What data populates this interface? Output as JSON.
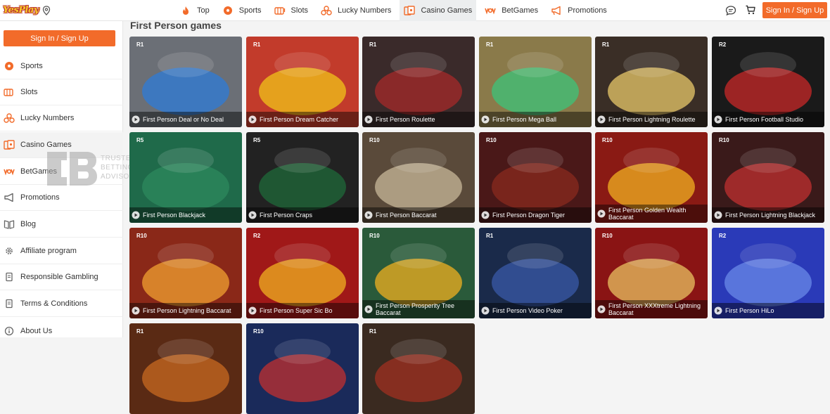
{
  "brand": {
    "logo_text": "YesPlay",
    "accent": "#f26b2a"
  },
  "nav": [
    {
      "label": "Top",
      "icon": "fire-icon"
    },
    {
      "label": "Sports",
      "icon": "soccer-ball-icon"
    },
    {
      "label": "Slots",
      "icon": "slots-icon"
    },
    {
      "label": "Lucky Numbers",
      "icon": "lottery-balls-icon"
    },
    {
      "label": "Casino Games",
      "icon": "casino-icon"
    },
    {
      "label": "BetGames",
      "icon": "betgames-icon"
    },
    {
      "label": "Promotions",
      "icon": "megaphone-icon"
    }
  ],
  "header": {
    "signin_label": "Sign In / Sign Up"
  },
  "sidebar": {
    "signin_label": "Sign In / Sign Up",
    "items": [
      {
        "label": "Sports",
        "icon": "soccer-ball-icon"
      },
      {
        "label": "Slots",
        "icon": "slots-icon"
      },
      {
        "label": "Lucky Numbers",
        "icon": "lottery-balls-icon"
      },
      {
        "label": "Casino Games",
        "icon": "casino-icon"
      },
      {
        "label": "BetGames",
        "icon": "betgames-icon"
      },
      {
        "label": "Promotions",
        "icon": "megaphone-icon"
      },
      {
        "label": "Blog",
        "icon": "book-icon"
      },
      {
        "label": "Affiliate program",
        "icon": "gear-icon"
      },
      {
        "label": "Responsible Gambling",
        "icon": "document-icon"
      },
      {
        "label": "Terms & Conditions",
        "icon": "document-icon"
      },
      {
        "label": "About Us",
        "icon": "info-icon"
      }
    ]
  },
  "watermark": {
    "line1": "TRUSTED",
    "line2": "BETTING",
    "line3": "ADVISOR"
  },
  "section": {
    "title": "First Person games"
  },
  "games": [
    {
      "name": "First Person Deal or No Deal",
      "badge": "R1",
      "bg": "#6b6f76",
      "accent": "#2d7bd8"
    },
    {
      "name": "First Person Dream Catcher",
      "badge": "R1",
      "bg": "#c23b2b",
      "accent": "#f0c419"
    },
    {
      "name": "First Person Roulette",
      "badge": "R1",
      "bg": "#3a2a2a",
      "accent": "#a52a2a"
    },
    {
      "name": "First Person Mega Ball",
      "badge": "R1",
      "bg": "#8a7a4a",
      "accent": "#3cc47a"
    },
    {
      "name": "First Person Lightning Roulette",
      "badge": "R1",
      "bg": "#3a2e26",
      "accent": "#e8c86a"
    },
    {
      "name": "First Person Football Studio",
      "badge": "R2",
      "bg": "#1a1a1a",
      "accent": "#c82828"
    },
    {
      "name": "First Person Blackjack",
      "badge": "R5",
      "bg": "#1f6a4a",
      "accent": "#2d8a5e"
    },
    {
      "name": "First Person Craps",
      "badge": "R5",
      "bg": "#222",
      "accent": "#1f6a3a"
    },
    {
      "name": "First Person Baccarat",
      "badge": "R10",
      "bg": "#5a4a3a",
      "accent": "#c8b89a"
    },
    {
      "name": "First Person Dragon Tiger",
      "badge": "R10",
      "bg": "#4a1818",
      "accent": "#8a2a1e"
    },
    {
      "name": "First Person Golden Wealth Baccarat",
      "badge": "R10",
      "bg": "#8a1a14",
      "accent": "#f0b020"
    },
    {
      "name": "First Person Lightning Blackjack",
      "badge": "R10",
      "bg": "#3a1a1a",
      "accent": "#c03030"
    },
    {
      "name": "First Person Lightning Baccarat",
      "badge": "R10",
      "bg": "#8a2818",
      "accent": "#f0a030"
    },
    {
      "name": "First Person Super Sic Bo",
      "badge": "R2",
      "bg": "#a01818",
      "accent": "#f0b020"
    },
    {
      "name": "First Person Prosperity Tree Baccarat",
      "badge": "R10",
      "bg": "#2a5a3a",
      "accent": "#f0b020"
    },
    {
      "name": "First Person Video Poker",
      "badge": "R1",
      "bg": "#1a2a4a",
      "accent": "#3a5aa8"
    },
    {
      "name": "First Person XXXtreme Lightning Baccarat",
      "badge": "R10",
      "bg": "#8a1414",
      "accent": "#e8c060"
    },
    {
      "name": "First Person HiLo",
      "badge": "R2",
      "bg": "#2a3ab8",
      "accent": "#6a8ae8"
    },
    {
      "name": "",
      "badge": "R1",
      "bg": "#5a2a14",
      "accent": "#c86a20"
    },
    {
      "name": "",
      "badge": "R10",
      "bg": "#1a2a5a",
      "accent": "#c03030"
    },
    {
      "name": "",
      "badge": "R1",
      "bg": "#3a2a20",
      "accent": "#a03020"
    }
  ]
}
